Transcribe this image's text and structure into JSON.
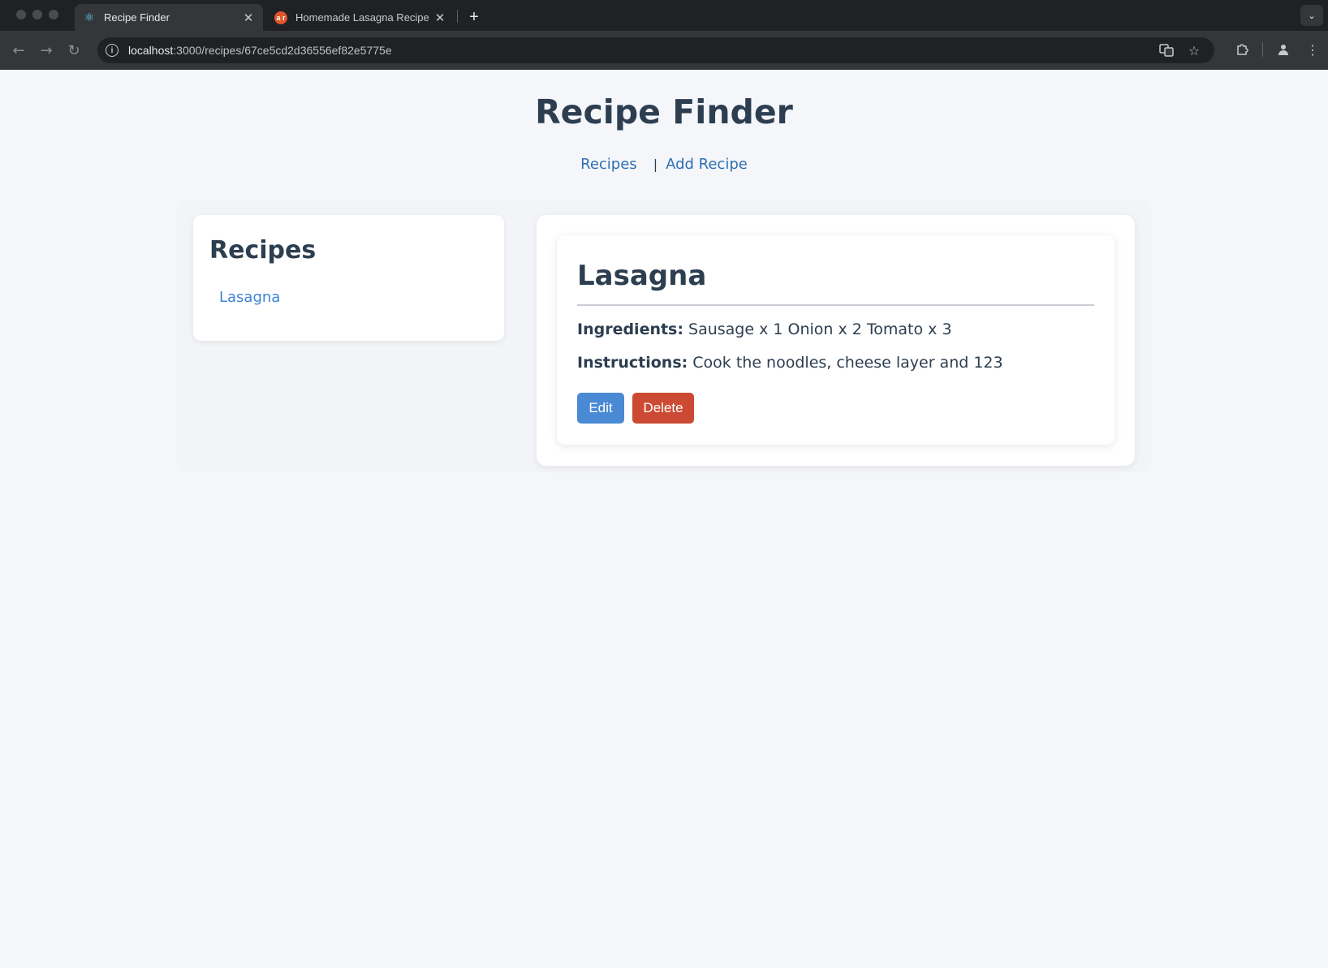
{
  "browser": {
    "tabs": [
      {
        "title": "Recipe Finder",
        "favicon": "react-icon",
        "active": true
      },
      {
        "title": "Homemade Lasagna Recipe",
        "favicon": "ar-logo-icon",
        "favicon_text": "a r",
        "active": false
      }
    ],
    "url_host": "localhost",
    "url_path": ":3000/recipes/67ce5cd2d36556ef82e5775e"
  },
  "site": {
    "title": "Recipe Finder",
    "nav": [
      {
        "label": "Recipes"
      },
      {
        "label": "Add Recipe"
      }
    ],
    "separator": "|"
  },
  "sidebar": {
    "heading": "Recipes",
    "items": [
      {
        "label": "Lasagna"
      }
    ]
  },
  "recipe": {
    "name": "Lasagna",
    "ingredients_label": "Ingredients:",
    "ingredients": "Sausage x 1 Onion x 2 Tomato x 3",
    "instructions_label": "Instructions:",
    "instructions": "Cook the noodles, cheese layer and 123",
    "edit_label": "Edit",
    "delete_label": "Delete"
  },
  "colors": {
    "accent": "#4a89d4",
    "danger": "#cc4a33",
    "link": "#2f6fb0",
    "text": "#2c3e50"
  }
}
